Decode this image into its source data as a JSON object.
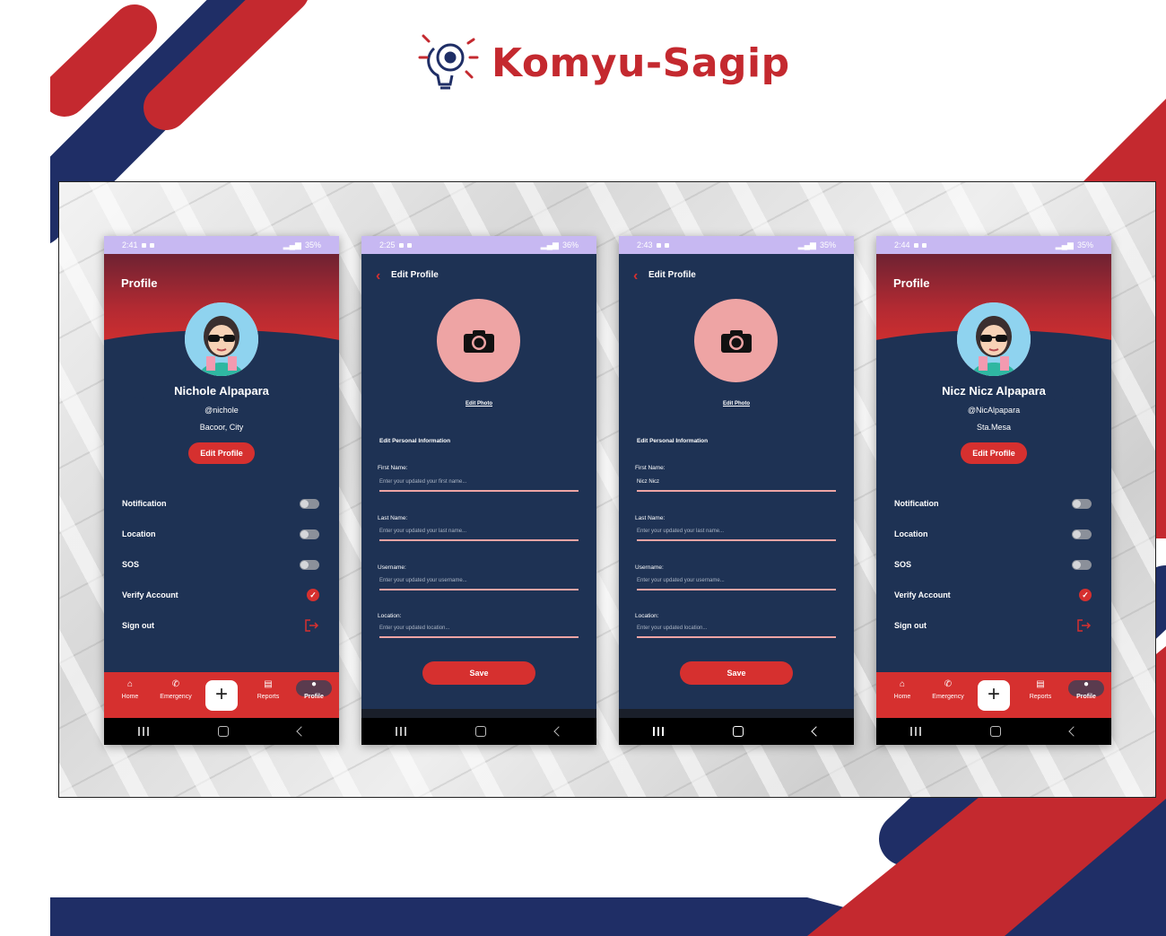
{
  "brand": {
    "title": "Komyu-Sagip",
    "color": "#c4292f",
    "logo_icon": "lightbulb-gear-icon"
  },
  "colors": {
    "navy": "#1e3254",
    "red": "#d6302f",
    "pink": "#eea4a4",
    "status_bar": "#c7b8f2"
  },
  "phones": [
    {
      "screen": "profile",
      "status": {
        "time": "2:41",
        "battery": "35%"
      },
      "title": "Profile",
      "name": "Nichole Alpapara",
      "username": "@nichole",
      "location": "Bacoor, City",
      "edit_button": "Edit Profile",
      "settings": [
        {
          "label": "Notification",
          "control": "toggle-off"
        },
        {
          "label": "Location",
          "control": "toggle-off"
        },
        {
          "label": "SOS",
          "control": "toggle-off"
        },
        {
          "label": "Verify Account",
          "control": "verified-badge-icon"
        },
        {
          "label": "Sign out",
          "control": "sign-out-icon"
        }
      ],
      "tabs": [
        "Home",
        "Emergency",
        "Reports",
        "Profile"
      ],
      "active_tab": "Profile"
    },
    {
      "screen": "edit-profile",
      "status": {
        "time": "2:25",
        "battery": "36%"
      },
      "title": "Edit Profile",
      "edit_photo": "Edit Photo",
      "section": "Edit Personal Information",
      "fields": [
        {
          "label": "First Name:",
          "placeholder": "Enter your updated your first name...",
          "value": ""
        },
        {
          "label": "Last Name:",
          "placeholder": "Enter your updated your last name...",
          "value": ""
        },
        {
          "label": "Username:",
          "placeholder": "Enter your updated your username...",
          "value": ""
        },
        {
          "label": "Location:",
          "placeholder": "Enter your updated location...",
          "value": ""
        }
      ],
      "save": "Save"
    },
    {
      "screen": "edit-profile",
      "status": {
        "time": "2:43",
        "battery": "35%"
      },
      "title": "Edit Profile",
      "edit_photo": "Edit Photo",
      "section": "Edit Personal Information",
      "fields": [
        {
          "label": "First Name:",
          "placeholder": "Enter your updated your first name...",
          "value": "Nicz Nicz"
        },
        {
          "label": "Last Name:",
          "placeholder": "Enter your updated your last name...",
          "value": ""
        },
        {
          "label": "Username:",
          "placeholder": "Enter your updated your username...",
          "value": ""
        },
        {
          "label": "Location:",
          "placeholder": "Enter your updated location...",
          "value": ""
        }
      ],
      "save": "Save"
    },
    {
      "screen": "profile",
      "status": {
        "time": "2:44",
        "battery": "35%"
      },
      "title": "Profile",
      "name": "Nicz Nicz Alpapara",
      "username": "@NicAlpapara",
      "location": "Sta.Mesa",
      "edit_button": "Edit Profile",
      "settings": [
        {
          "label": "Notification",
          "control": "toggle-off"
        },
        {
          "label": "Location",
          "control": "toggle-off"
        },
        {
          "label": "SOS",
          "control": "toggle-off"
        },
        {
          "label": "Verify Account",
          "control": "verified-badge-icon"
        },
        {
          "label": "Sign out",
          "control": "sign-out-icon"
        }
      ],
      "tabs": [
        "Home",
        "Emergency",
        "Reports",
        "Profile"
      ],
      "active_tab": "Profile"
    }
  ]
}
